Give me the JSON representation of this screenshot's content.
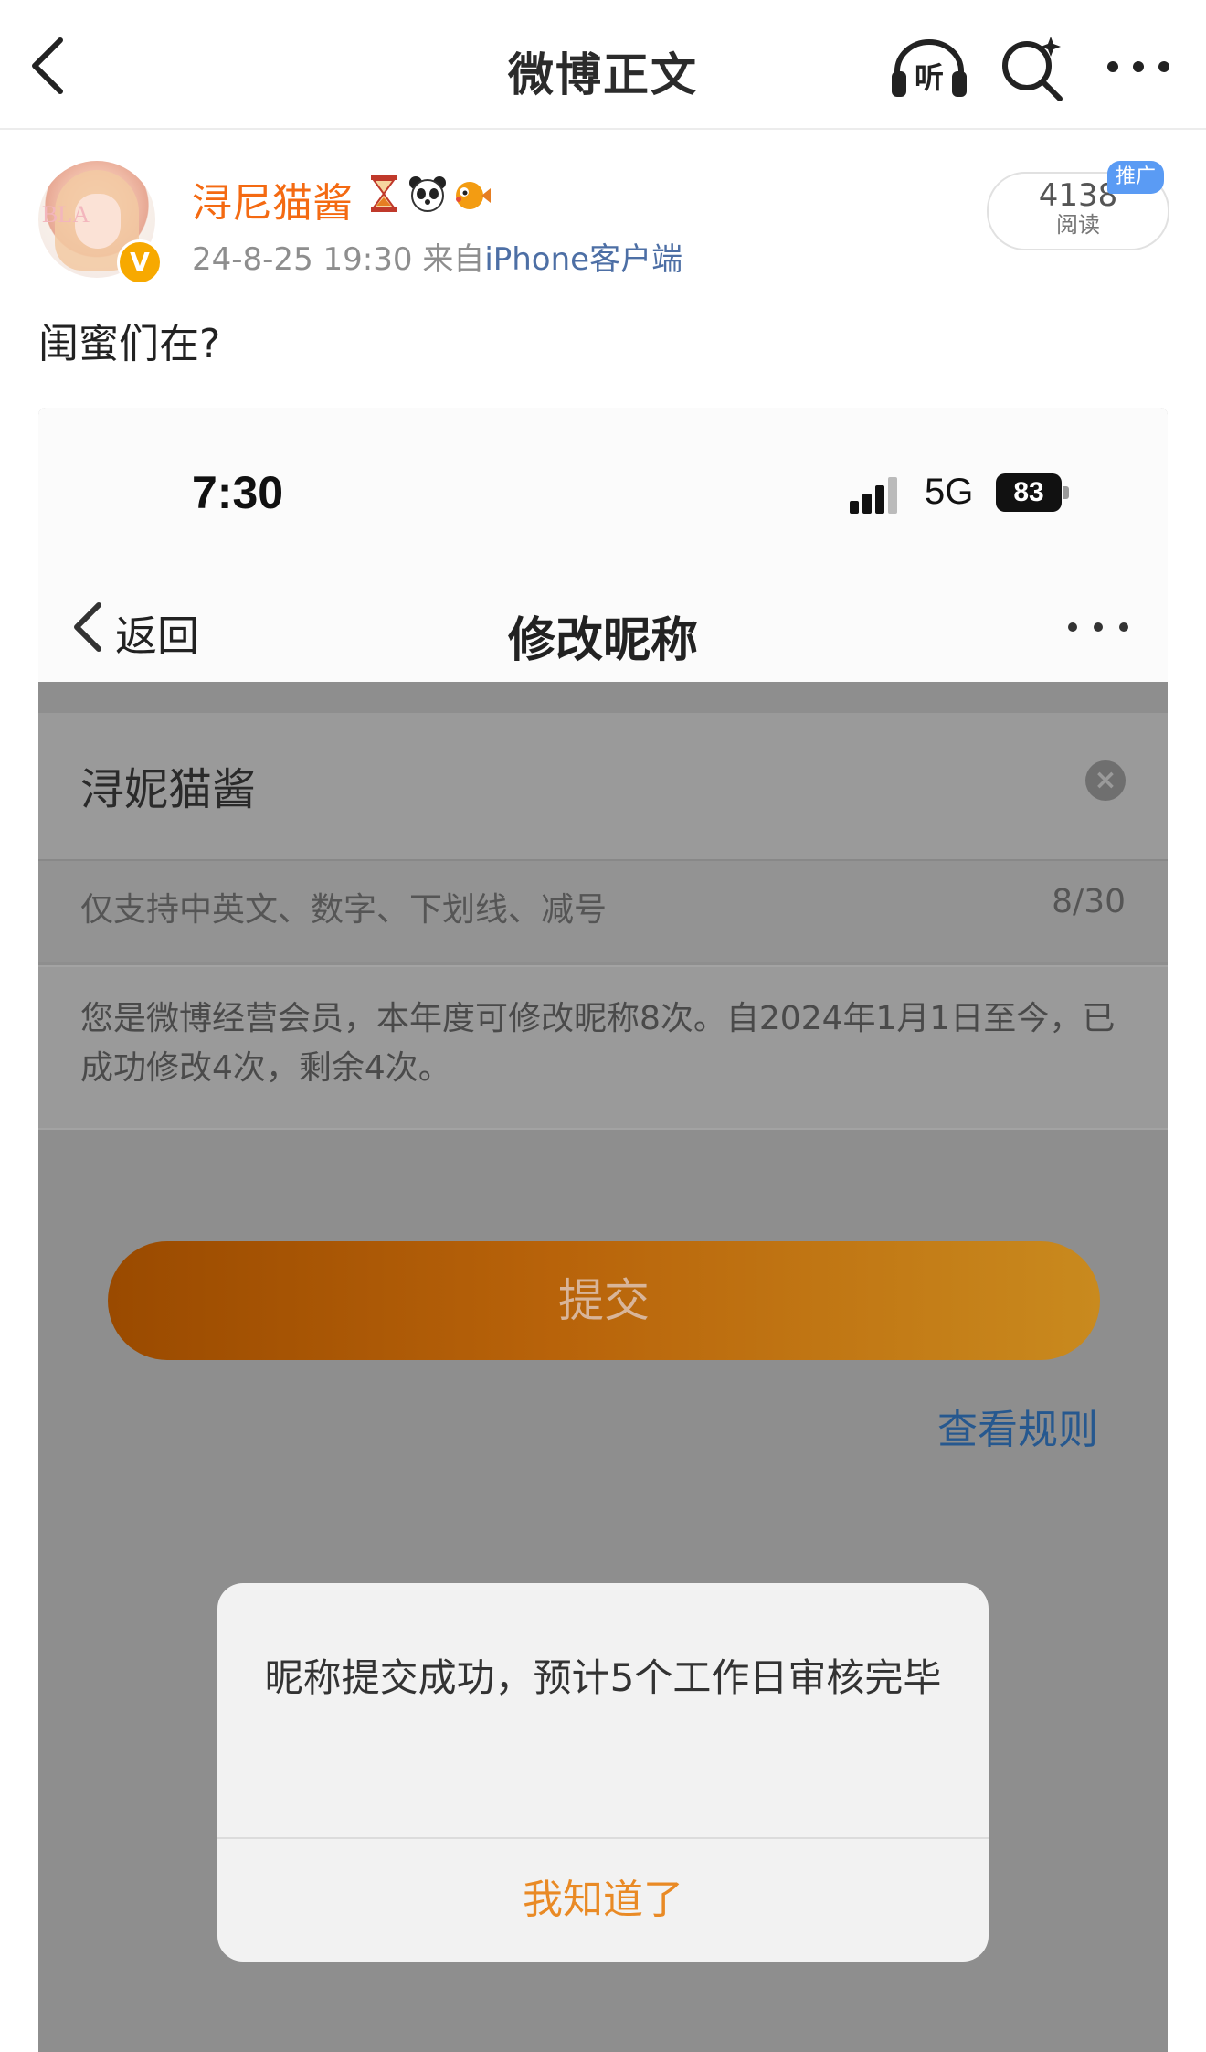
{
  "nav": {
    "title": "微博正文",
    "listen_glyph": "听",
    "icons": [
      "back-arrow-icon",
      "listen-headphones-icon",
      "ai-search-icon",
      "more-dots-icon"
    ]
  },
  "post": {
    "username": "浔尼猫酱",
    "username_color": "#f46a12",
    "emoji_icons": [
      "hourglass-icon",
      "panda-icon",
      "pufferfish-icon"
    ],
    "avatar_watermark": "BLA",
    "verified_badge": "V",
    "date": "24-8-25 19:30",
    "source_prefix": "来自",
    "source": "iPhone客户端",
    "read_count": "4138",
    "read_label": "阅读",
    "promo_tag": "推广",
    "text": "闺蜜们在?"
  },
  "screenshot": {
    "status_time": "7:30",
    "network": "5G",
    "battery": "83",
    "back_label": "返回",
    "title": "修改昵称",
    "nickname_value": "浔妮猫酱",
    "hint": "仅支持中英文、数字、下划线、减号",
    "char_count": "8/30",
    "info": "您是微博经营会员，本年度可修改昵称8次。自2024年1月1日至今，已成功修改4次，剩余4次。",
    "submit_label": "提交",
    "rules_link": "查看规则",
    "dialog_message": "昵称提交成功，预计5个工作日审核完毕",
    "dialog_button": "我知道了",
    "accent_color": "#e98a25",
    "link_color": "#26588f"
  }
}
